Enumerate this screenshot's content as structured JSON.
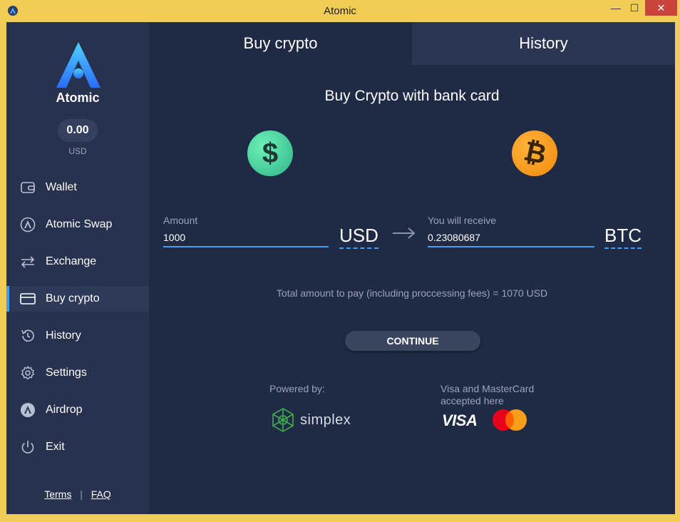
{
  "window": {
    "title": "Atomic",
    "controls": {
      "minimize": "—",
      "maximize": "☐",
      "close": "✕"
    }
  },
  "sidebar": {
    "brand": "Atomic",
    "balance": "0.00",
    "balance_currency": "USD",
    "items": [
      {
        "label": "Wallet",
        "icon": "wallet-icon",
        "active": false
      },
      {
        "label": "Atomic Swap",
        "icon": "atomic-swap-icon",
        "active": false
      },
      {
        "label": "Exchange",
        "icon": "exchange-icon",
        "active": false
      },
      {
        "label": "Buy crypto",
        "icon": "card-icon",
        "active": true
      },
      {
        "label": "History",
        "icon": "history-icon",
        "active": false
      },
      {
        "label": "Settings",
        "icon": "gear-icon",
        "active": false
      },
      {
        "label": "Airdrop",
        "icon": "airdrop-icon",
        "active": false
      },
      {
        "label": "Exit",
        "icon": "power-icon",
        "active": false
      }
    ],
    "footer": {
      "terms": "Terms",
      "separator": "|",
      "faq": "FAQ"
    }
  },
  "tabs": [
    {
      "label": "Buy crypto",
      "active": true
    },
    {
      "label": "History",
      "active": false
    }
  ],
  "main": {
    "title": "Buy Crypto with bank card",
    "from_coin_symbol": "$",
    "to_coin_symbol": "₿",
    "amount": {
      "label": "Amount",
      "value": "1000",
      "currency": "USD"
    },
    "receive": {
      "label": "You will receive",
      "value": "0.23080687",
      "currency": "BTC"
    },
    "total": "Total amount to pay (including proccessing fees) = 1070 USD",
    "continue_label": "CONTINUE",
    "powered_by": "Powered by:",
    "provider": "simplex",
    "cards_text": "Visa and MasterCard accepted here",
    "visa": "VISA"
  },
  "colors": {
    "accent": "#3aa0ff",
    "background": "#1f2b45",
    "sidebar": "#27324f",
    "window_frame": "#f2cd55",
    "close_button": "#c9443a"
  }
}
